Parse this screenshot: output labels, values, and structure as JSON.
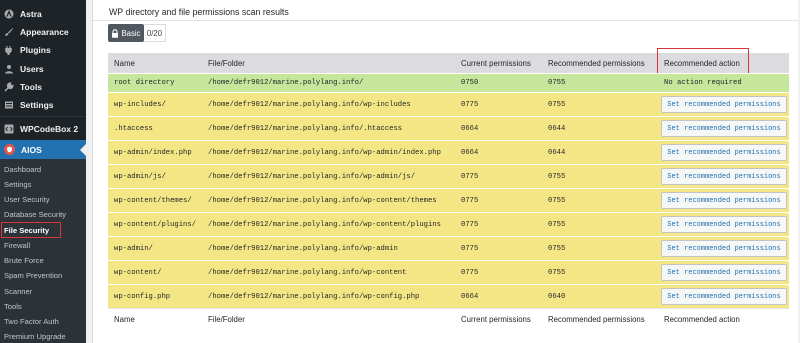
{
  "sidebar": {
    "menu": [
      {
        "label": "Astra",
        "icon": "astra-icon"
      },
      {
        "label": "Appearance",
        "icon": "paintbrush-icon"
      },
      {
        "label": "Plugins",
        "icon": "plugin-icon"
      },
      {
        "label": "Users",
        "icon": "users-icon"
      },
      {
        "label": "Tools",
        "icon": "wrench-icon"
      },
      {
        "label": "Settings",
        "icon": "settings-icon"
      },
      {
        "label": "WPCodeBox 2",
        "icon": "codebox-icon"
      }
    ],
    "active_menu": {
      "label": "AIOS",
      "icon": "shield-icon"
    },
    "submenu": [
      "Dashboard",
      "Settings",
      "User Security",
      "Database Security",
      "File Security",
      "Firewall",
      "Brute Force",
      "Spam Prevention",
      "Scanner",
      "Tools",
      "Two Factor Auth",
      "Premium Upgrade"
    ],
    "current_submenu": "File Security"
  },
  "main": {
    "title": "WP directory and file permissions scan results",
    "badge_label": "Basic",
    "score": "0/20",
    "columns": [
      "Name",
      "File/Folder",
      "Current permissions",
      "Recommended permissions",
      "Recommended action"
    ],
    "rows": [
      {
        "name": "root directory",
        "path": "/home/defr9012/marine.polylang.info/",
        "current": "0750",
        "recommended": "0755",
        "action": "No action required",
        "status": "ok"
      },
      {
        "name": "wp-includes/",
        "path": "/home/defr9012/marine.polylang.info/wp-includes",
        "current": "0775",
        "recommended": "0755",
        "action": "Set recommended permissions",
        "status": "warn"
      },
      {
        "name": ".htaccess",
        "path": "/home/defr9012/marine.polylang.info/.htaccess",
        "current": "0664",
        "recommended": "0644",
        "action": "Set recommended permissions",
        "status": "warn"
      },
      {
        "name": "wp-admin/index.php",
        "path": "/home/defr9012/marine.polylang.info/wp-admin/index.php",
        "current": "0664",
        "recommended": "0644",
        "action": "Set recommended permissions",
        "status": "warn"
      },
      {
        "name": "wp-admin/js/",
        "path": "/home/defr9012/marine.polylang.info/wp-admin/js/",
        "current": "0775",
        "recommended": "0755",
        "action": "Set recommended permissions",
        "status": "warn"
      },
      {
        "name": "wp-content/themes/",
        "path": "/home/defr9012/marine.polylang.info/wp-content/themes",
        "current": "0775",
        "recommended": "0755",
        "action": "Set recommended permissions",
        "status": "warn"
      },
      {
        "name": "wp-content/plugins/",
        "path": "/home/defr9012/marine.polylang.info/wp-content/plugins",
        "current": "0775",
        "recommended": "0755",
        "action": "Set recommended permissions",
        "status": "warn"
      },
      {
        "name": "wp-admin/",
        "path": "/home/defr9012/marine.polylang.info/wp-admin",
        "current": "0775",
        "recommended": "0755",
        "action": "Set recommended permissions",
        "status": "warn"
      },
      {
        "name": "wp-content/",
        "path": "/home/defr9012/marine.polylang.info/wp-content",
        "current": "0775",
        "recommended": "0755",
        "action": "Set recommended permissions",
        "status": "warn"
      },
      {
        "name": "wp-config.php",
        "path": "/home/defr9012/marine.polylang.info/wp-config.php",
        "current": "0664",
        "recommended": "0640",
        "action": "Set recommended permissions",
        "status": "warn"
      }
    ]
  },
  "colors": {
    "sidebar_bg": "#1d2327",
    "accent": "#2271b1",
    "ok_row": "#c5e69b",
    "warn_row": "#f5e685",
    "highlight": "#d63638"
  }
}
